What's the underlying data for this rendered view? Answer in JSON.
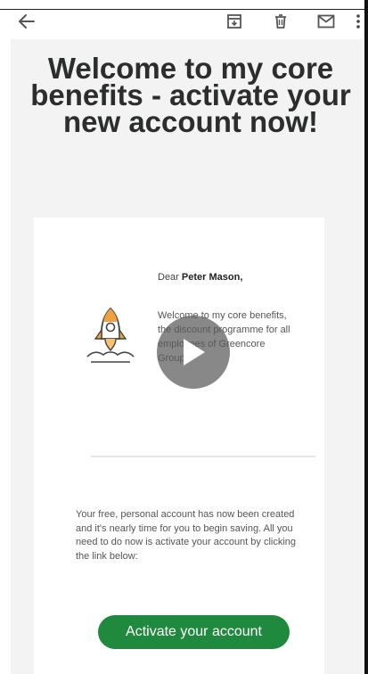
{
  "toolbar": {
    "back_icon": "arrow-left-icon",
    "archive_icon": "archive-icon",
    "delete_icon": "trash-icon",
    "mail_icon": "envelope-icon",
    "more_icon": "more-vertical-icon"
  },
  "email": {
    "headline": "Welcome to my core benefits - activate your new account now!",
    "greeting_prefix": "Dear ",
    "recipient_name": "Peter Mason,",
    "intro_text": "Welcome to my core benefits, the discount programme for all employees of Greencore Group.",
    "body_text": "Your free, personal account has now been created and it's nearly time for you to begin saving. All you need to do now is activate your account by clicking the link below:",
    "cta_label": "Activate your account",
    "illustration_icon": "rocket-icon",
    "video_overlay_icon": "play-icon"
  },
  "colors": {
    "cta_background": "#1f8a3e",
    "rocket_accent": "#f0a13b",
    "email_background": "#f2f3f2"
  }
}
